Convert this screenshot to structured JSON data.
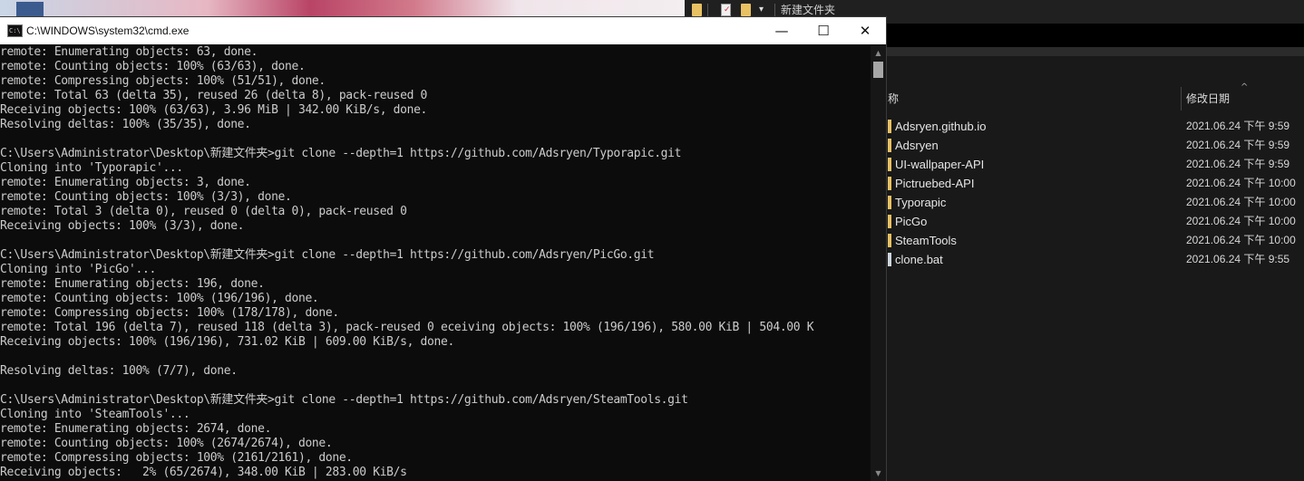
{
  "explorer": {
    "title": "新建文件夹",
    "columns": {
      "name": "称",
      "date": "修改日期"
    },
    "files": [
      {
        "name": "Adsryen.github.io",
        "date": "2021.06.24 下午 9:59",
        "type": "folder"
      },
      {
        "name": "Adsryen",
        "date": "2021.06.24 下午 9:59",
        "type": "folder"
      },
      {
        "name": "UI-wallpaper-API",
        "date": "2021.06.24 下午 9:59",
        "type": "folder"
      },
      {
        "name": "Pictruebed-API",
        "date": "2021.06.24 下午 10:00",
        "type": "folder"
      },
      {
        "name": "Typorapic",
        "date": "2021.06.24 下午 10:00",
        "type": "folder"
      },
      {
        "name": "PicGo",
        "date": "2021.06.24 下午 10:00",
        "type": "folder"
      },
      {
        "name": "SteamTools",
        "date": "2021.06.24 下午 10:00",
        "type": "folder"
      },
      {
        "name": "clone.bat",
        "date": "2021.06.24 下午 9:55",
        "type": "bat"
      }
    ]
  },
  "cmd": {
    "title": "C:\\WINDOWS\\system32\\cmd.exe",
    "icon_text": "C:\\",
    "controls": {
      "minimize": "—",
      "maximize": "☐",
      "close": "✕"
    },
    "lines": [
      "remote: Enumerating objects: 63, done.",
      "remote: Counting objects: 100% (63/63), done.",
      "remote: Compressing objects: 100% (51/51), done.",
      "remote: Total 63 (delta 35), reused 26 (delta 8), pack-reused 0",
      "Receiving objects: 100% (63/63), 3.96 MiB | 342.00 KiB/s, done.",
      "Resolving deltas: 100% (35/35), done.",
      "",
      "C:\\Users\\Administrator\\Desktop\\新建文件夹>git clone --depth=1 https://github.com/Adsryen/Typorapic.git",
      "Cloning into 'Typorapic'...",
      "remote: Enumerating objects: 3, done.",
      "remote: Counting objects: 100% (3/3), done.",
      "remote: Total 3 (delta 0), reused 0 (delta 0), pack-reused 0",
      "Receiving objects: 100% (3/3), done.",
      "",
      "C:\\Users\\Administrator\\Desktop\\新建文件夹>git clone --depth=1 https://github.com/Adsryen/PicGo.git",
      "Cloning into 'PicGo'...",
      "remote: Enumerating objects: 196, done.",
      "remote: Counting objects: 100% (196/196), done.",
      "remote: Compressing objects: 100% (178/178), done.",
      "remote: Total 196 (delta 7), reused 118 (delta 3), pack-reused 0 eceiving objects: 100% (196/196), 580.00 KiB | 504.00 K",
      "Receiving objects: 100% (196/196), 731.02 KiB | 609.00 KiB/s, done.",
      "",
      "Resolving deltas: 100% (7/7), done.",
      "",
      "C:\\Users\\Administrator\\Desktop\\新建文件夹>git clone --depth=1 https://github.com/Adsryen/SteamTools.git",
      "Cloning into 'SteamTools'...",
      "remote: Enumerating objects: 2674, done.",
      "remote: Counting objects: 100% (2674/2674), done.",
      "remote: Compressing objects: 100% (2161/2161), done.",
      "Receiving objects:   2% (65/2674), 348.00 KiB | 283.00 KiB/s"
    ]
  }
}
